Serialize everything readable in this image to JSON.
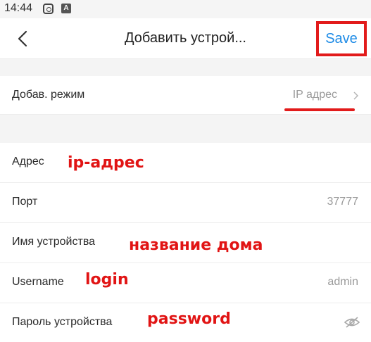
{
  "status_bar": {
    "time": "14:44",
    "icons": [
      "instagram-icon",
      "a-app-icon"
    ],
    "app_icon_letter": "A"
  },
  "header": {
    "title": "Добавить устрой...",
    "save_label": "Save",
    "back_icon": "chevron-left-icon"
  },
  "mode_row": {
    "label": "Добав. режим",
    "value": "IP адрес"
  },
  "fields": {
    "address": {
      "label": "Адрес",
      "value": ""
    },
    "port": {
      "label": "Порт",
      "value": "37777"
    },
    "device_name": {
      "label": "Имя устройства",
      "value": ""
    },
    "username": {
      "label": "Username",
      "value": "admin"
    },
    "password": {
      "label": "Пароль устройства",
      "value": "",
      "icon": "eye-hidden-icon"
    }
  },
  "annotations": {
    "address": "ip-адрес",
    "device_name": "название дома",
    "username": "login",
    "password": "password"
  },
  "colors": {
    "accent": "#1e8be6",
    "annotation": "#e11414",
    "background_gap": "#f4f4f4"
  }
}
